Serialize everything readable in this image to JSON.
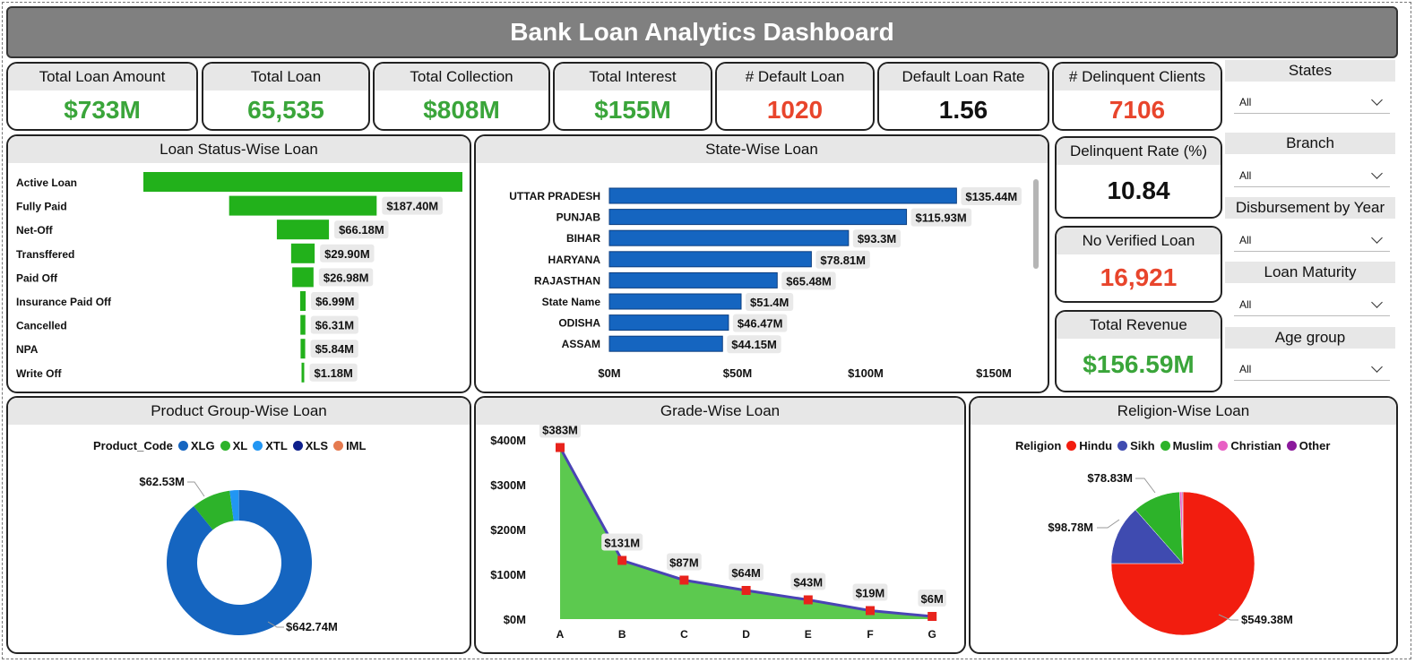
{
  "title": "Bank Loan Analytics Dashboard",
  "kpis": [
    {
      "label": "Total Loan Amount",
      "value": "$733M",
      "color": "#3aa53a"
    },
    {
      "label": "Total Loan",
      "value": "65,535",
      "color": "#3aa53a"
    },
    {
      "label": "Total Collection",
      "value": "$808M",
      "color": "#3aa53a"
    },
    {
      "label": "Total Interest",
      "value": "$155M",
      "color": "#3aa53a"
    },
    {
      "label": "# Default Loan",
      "value": "1020",
      "color": "#e8452c"
    },
    {
      "label": "Default Loan Rate",
      "value": "1.56",
      "color": "#111111"
    },
    {
      "label": "# Delinquent Clients",
      "value": "7106",
      "color": "#e8452c"
    }
  ],
  "side_kpis": [
    {
      "label": "Delinquent Rate (%)",
      "value": "10.84",
      "color": "#111111"
    },
    {
      "label": "No Verified Loan",
      "value": "16,921",
      "color": "#e8452c"
    },
    {
      "label": "Total Revenue",
      "value": "$156.59M",
      "color": "#3aa53a"
    }
  ],
  "slicers": [
    {
      "label": "States",
      "value": "All"
    },
    {
      "label": "Branch",
      "value": "All"
    },
    {
      "label": "Disbursement by Year",
      "value": "All"
    },
    {
      "label": "Loan Maturity",
      "value": "All"
    },
    {
      "label": "Age group",
      "value": "All"
    }
  ],
  "chart_data": [
    {
      "type": "bar",
      "title": "Loan Status-Wise Loan",
      "orientation": "horizontal-funnel",
      "categories": [
        "Active Loan",
        "Fully Paid",
        "Net-Off",
        "Transffered",
        "Paid Off",
        "Insurance Paid Off",
        "Cancelled",
        "NPA",
        "Write Off"
      ],
      "values": [
        405.2,
        187.4,
        66.18,
        29.9,
        26.98,
        6.99,
        6.31,
        5.84,
        1.18
      ],
      "labels": [
        "",
        "$187.40M",
        "$66.18M",
        "$29.90M",
        "$26.98M",
        "$6.99M",
        "$6.31M",
        "$5.84M",
        "$1.18M"
      ],
      "color": "#22b11b"
    },
    {
      "type": "bar",
      "title": "State-Wise Loan",
      "orientation": "horizontal",
      "categories": [
        "UTTAR PRADESH",
        "PUNJAB",
        "BIHAR",
        "HARYANA",
        "RAJASTHAN",
        "State Name",
        "ODISHA",
        "ASSAM"
      ],
      "values": [
        135.44,
        115.93,
        93.3,
        78.81,
        65.48,
        51.4,
        46.47,
        44.15
      ],
      "labels": [
        "$135.44M",
        "$115.93M",
        "$93.3M",
        "$78.81M",
        "$65.48M",
        "$51.4M",
        "$46.47M",
        "$44.15M"
      ],
      "xticks": [
        "$0M",
        "$50M",
        "$100M",
        "$150M"
      ],
      "xlim": [
        0,
        150
      ],
      "color": "#1565c0"
    },
    {
      "type": "pie",
      "title": "Product Group-Wise Loan",
      "donut": true,
      "legend_title": "Product_Code",
      "slices": [
        {
          "name": "XLG",
          "value": 642.74,
          "label": "$642.74M",
          "color": "#1565c0"
        },
        {
          "name": "XL",
          "value": 62.53,
          "label": "$62.53M",
          "color": "#2db32a"
        },
        {
          "name": "XTL",
          "value": 15.0,
          "label": "",
          "color": "#2196f3"
        },
        {
          "name": "XLS",
          "value": 0.2,
          "label": "",
          "color": "#0d1f8c"
        },
        {
          "name": "IML",
          "value": 0.1,
          "label": "",
          "color": "#e57a4f"
        }
      ]
    },
    {
      "type": "area",
      "title": "Grade-Wise Loan",
      "categories": [
        "A",
        "B",
        "C",
        "D",
        "E",
        "F",
        "G"
      ],
      "values": [
        383,
        131,
        87,
        64,
        43,
        19,
        6
      ],
      "labels": [
        "$383M",
        "$131M",
        "$87M",
        "$64M",
        "$43M",
        "$19M",
        "$6M"
      ],
      "yticks": [
        "$0M",
        "$100M",
        "$200M",
        "$300M",
        "$400M"
      ],
      "ylim": [
        0,
        400
      ],
      "fill": "#5cc94f",
      "line": "#4a44b5",
      "marker": "#e8231c"
    },
    {
      "type": "pie",
      "title": "Religion-Wise Loan",
      "legend_title": "Religion",
      "slices": [
        {
          "name": "Hindu",
          "value": 549.38,
          "label": "$549.38M",
          "color": "#f21d0f"
        },
        {
          "name": "Sikh",
          "value": 98.78,
          "label": "$98.78M",
          "color": "#3f4bb0"
        },
        {
          "name": "Muslim",
          "value": 78.83,
          "label": "$78.83M",
          "color": "#2db32a"
        },
        {
          "name": "Christian",
          "value": 4.0,
          "label": "",
          "color": "#e860c4"
        },
        {
          "name": "Other",
          "value": 1.5,
          "label": "",
          "color": "#8b1a9c"
        }
      ]
    }
  ]
}
